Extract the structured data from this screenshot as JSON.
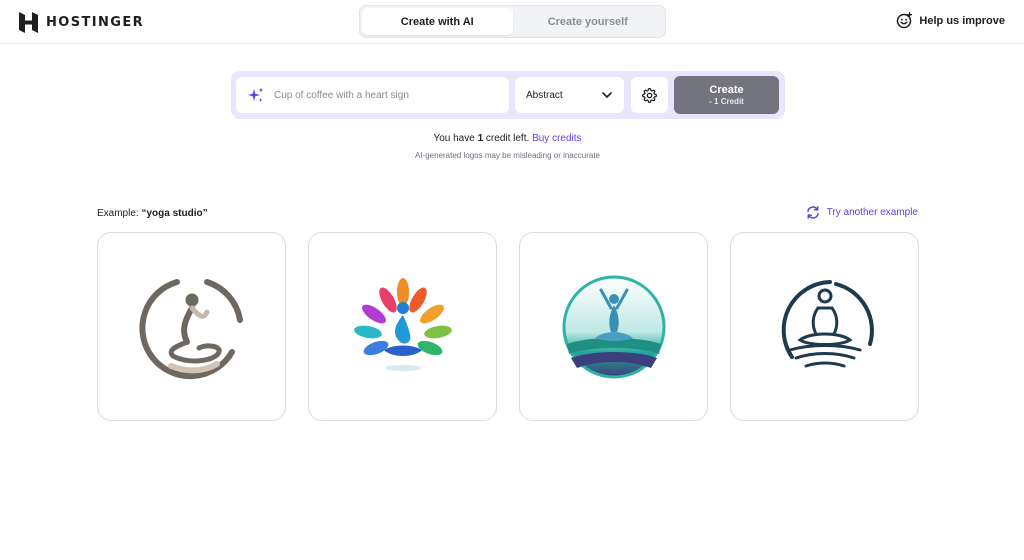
{
  "header": {
    "brand": "HOSTINGER",
    "tabs": [
      {
        "label": "Create with AI",
        "active": true
      },
      {
        "label": "Create yourself",
        "active": false
      }
    ],
    "help_label": "Help us improve"
  },
  "prompt": {
    "placeholder": "Cup of coffee with a heart sign",
    "value": "",
    "style_selected": "Abstract",
    "create_label": "Create",
    "create_cost": "- 1 Credit"
  },
  "credits": {
    "prefix": "You have",
    "count": "1",
    "suffix": "credit left.",
    "buy_label": "Buy credits",
    "disclaimer": "AI-generated logos may be misleading or inaccurate"
  },
  "examples": {
    "label_prefix": "Example:",
    "query": "“yoga studio”",
    "try_another_label": "Try another example"
  },
  "colors": {
    "accent": "#673de6",
    "prompt_bar_bg": "#ebe4ff",
    "create_button_bg": "#747481"
  },
  "icons": {
    "brand": "hostinger-logo-icon",
    "help": "smiley-feedback-icon",
    "sparkle": "sparkle-icon",
    "dropdown": "chevron-down-icon",
    "settings": "gear-icon",
    "refresh": "refresh-icon"
  }
}
